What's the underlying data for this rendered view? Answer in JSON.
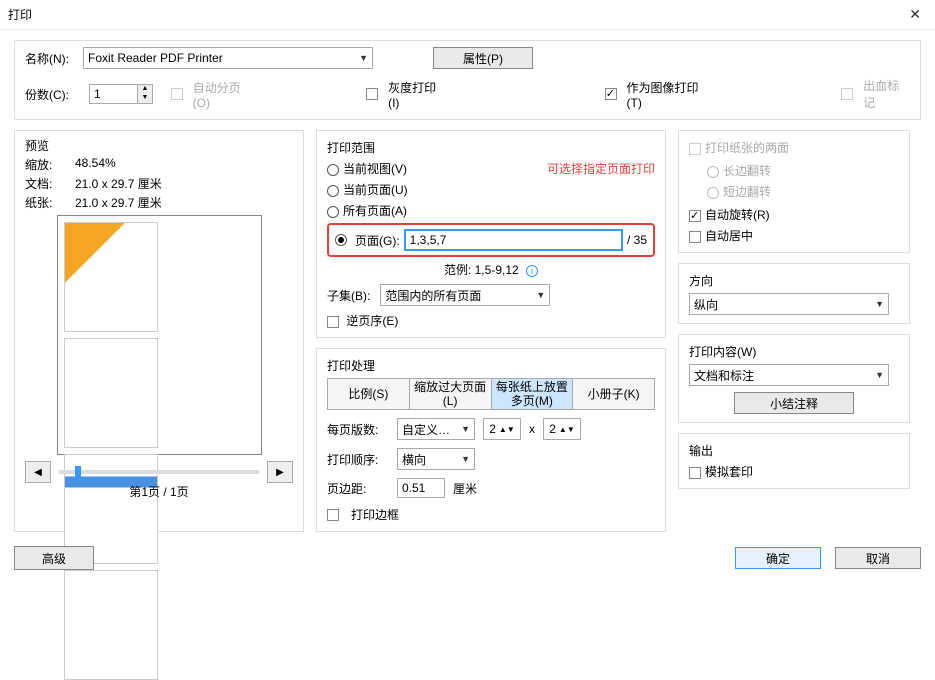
{
  "title": "打印",
  "top": {
    "name_label": "名称(N):",
    "printer": "Foxit Reader PDF Printer",
    "props_btn": "属性(P)",
    "copies_label": "份数(C):",
    "copies_value": "1",
    "collate_label": "自动分页(O)",
    "gray_label": "灰度打印(I)",
    "asimage_label": "作为图像打印(T)",
    "bleed_label": "出血标记"
  },
  "preview": {
    "title": "预览",
    "zoom_label": "缩放:",
    "zoom_value": "48.54%",
    "doc_label": "文档:",
    "doc_value": "21.0 x 29.7 厘米",
    "paper_label": "纸张:",
    "paper_value": "21.0 x 29.7 厘米",
    "page_count": "第1页 / 1页"
  },
  "range": {
    "title": "打印范围",
    "current_view": "当前视图(V)",
    "current_page": "当前页面(U)",
    "all_pages": "所有页面(A)",
    "pages": "页面(G):",
    "pages_value": "1,3,5,7",
    "pages_total": "/ 35",
    "note": "可选择指定页面打印",
    "example_label": "范例: 1,5-9,12",
    "subset_label": "子集(B):",
    "subset_value": "范围内的所有页面",
    "reverse_label": "逆页序(E)"
  },
  "handling": {
    "title": "打印处理",
    "tabs": {
      "scale": "比例(S)",
      "large": "缩放过大页面(L)",
      "multi": "每张纸上放置多页(M)",
      "booklet": "小册子(K)"
    },
    "per_page_label": "每页版数:",
    "custom_value": "自定义…",
    "per_page_x": "2",
    "per_page_y": "2",
    "x_label": "x",
    "order_label": "打印顺序:",
    "order_value": "横向",
    "margin_label": "页边距:",
    "margin_value": "0.51",
    "margin_unit": "厘米",
    "border_label": "打印边框"
  },
  "duplex": {
    "both_sides": "打印纸张的两面",
    "long_edge": "长边翻转",
    "short_edge": "短边翻转",
    "autorotate": "自动旋转(R)",
    "autocenter": "自动居中"
  },
  "direction": {
    "title": "方向",
    "value": "纵向"
  },
  "content": {
    "title": "打印内容(W)",
    "value": "文档和标注",
    "notes_btn": "小结注释"
  },
  "output": {
    "title": "输出",
    "sim_label": "模拟套印"
  },
  "buttons": {
    "advanced": "高级",
    "ok": "确定",
    "cancel": "取消"
  }
}
